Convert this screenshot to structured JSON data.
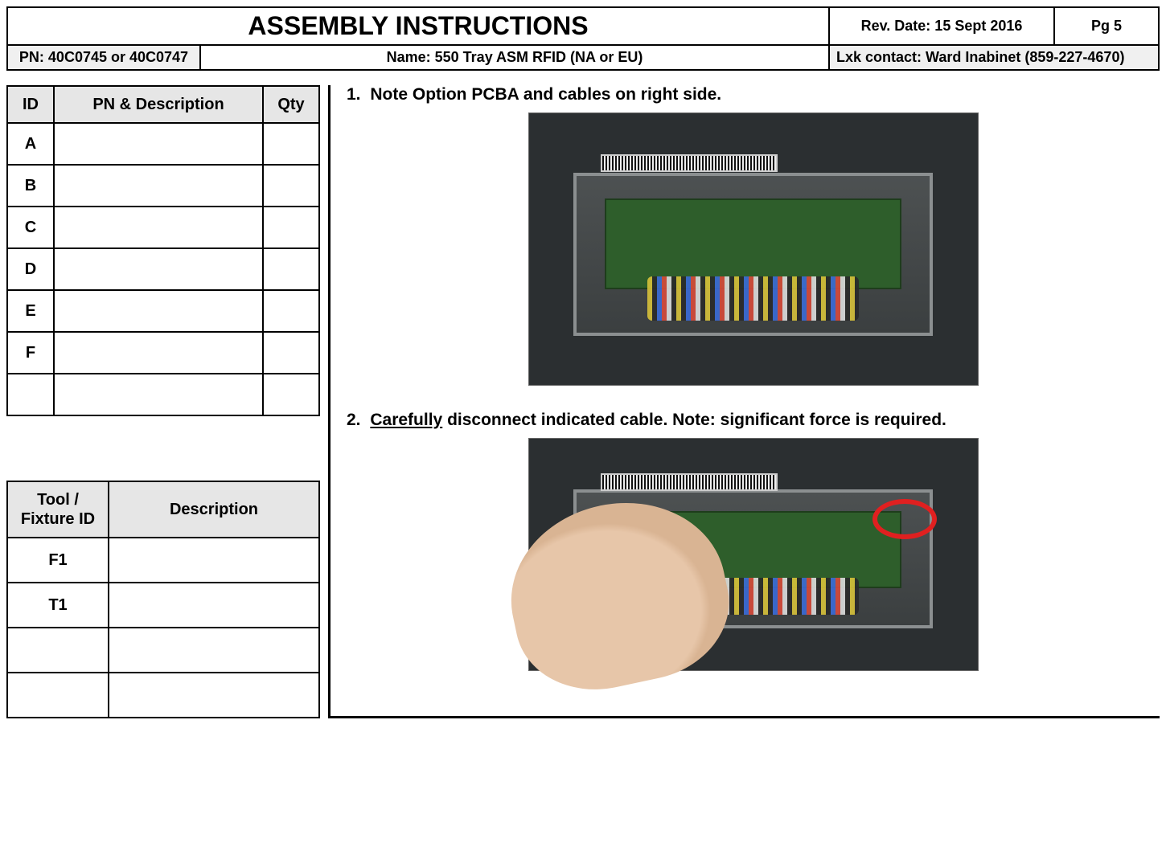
{
  "header": {
    "title": "ASSEMBLY INSTRUCTIONS",
    "rev_date": "Rev. Date: 15 Sept 2016",
    "page": "Pg  5",
    "pn": "PN:  40C0745 or 40C0747",
    "name": "Name:  550 Tray ASM RFID (NA or EU)",
    "contact": "Lxk contact: Ward Inabinet (859-227-4670)"
  },
  "parts_table": {
    "headers": {
      "id": "ID",
      "desc": "PN & Description",
      "qty": "Qty"
    },
    "rows": [
      {
        "id": "A",
        "desc": "",
        "qty": ""
      },
      {
        "id": "B",
        "desc": "",
        "qty": ""
      },
      {
        "id": "C",
        "desc": "",
        "qty": ""
      },
      {
        "id": "D",
        "desc": "",
        "qty": ""
      },
      {
        "id": "E",
        "desc": "",
        "qty": ""
      },
      {
        "id": "F",
        "desc": "",
        "qty": ""
      },
      {
        "id": "",
        "desc": "",
        "qty": ""
      }
    ]
  },
  "tools_table": {
    "headers": {
      "id": "Tool / Fixture ID",
      "desc": "Description"
    },
    "rows": [
      {
        "id": "F1",
        "desc": ""
      },
      {
        "id": "T1",
        "desc": ""
      },
      {
        "id": "",
        "desc": ""
      },
      {
        "id": "",
        "desc": ""
      }
    ]
  },
  "steps": {
    "s1": {
      "num": "1.",
      "text": "Note Option PCBA and cables on right side."
    },
    "s2": {
      "num": "2.",
      "underlined": "Carefully",
      "rest": " disconnect indicated cable.  Note: significant force is required."
    }
  }
}
